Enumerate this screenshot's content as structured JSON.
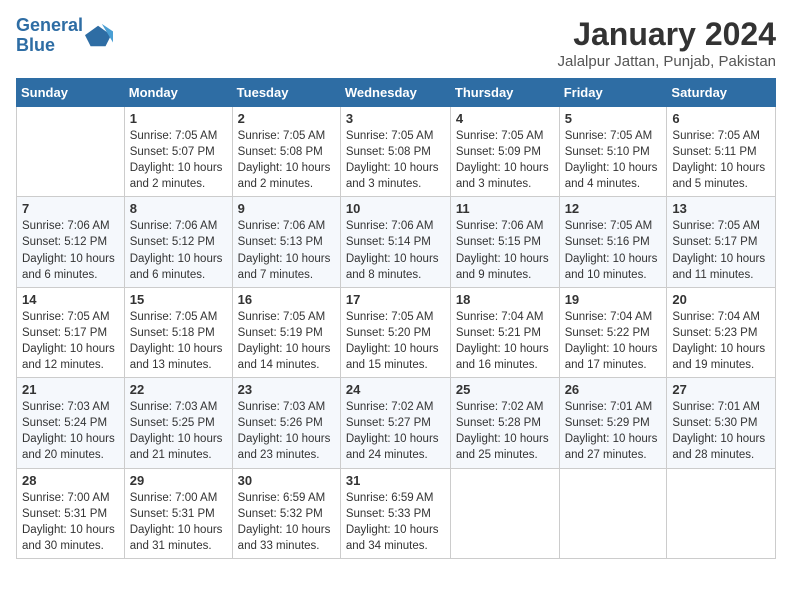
{
  "header": {
    "logo_line1": "General",
    "logo_line2": "Blue",
    "title": "January 2024",
    "subtitle": "Jalalpur Jattan, Punjab, Pakistan"
  },
  "weekdays": [
    "Sunday",
    "Monday",
    "Tuesday",
    "Wednesday",
    "Thursday",
    "Friday",
    "Saturday"
  ],
  "weeks": [
    [
      {
        "day": "",
        "info": ""
      },
      {
        "day": "1",
        "info": "Sunrise: 7:05 AM\nSunset: 5:07 PM\nDaylight: 10 hours\nand 2 minutes."
      },
      {
        "day": "2",
        "info": "Sunrise: 7:05 AM\nSunset: 5:08 PM\nDaylight: 10 hours\nand 2 minutes."
      },
      {
        "day": "3",
        "info": "Sunrise: 7:05 AM\nSunset: 5:08 PM\nDaylight: 10 hours\nand 3 minutes."
      },
      {
        "day": "4",
        "info": "Sunrise: 7:05 AM\nSunset: 5:09 PM\nDaylight: 10 hours\nand 3 minutes."
      },
      {
        "day": "5",
        "info": "Sunrise: 7:05 AM\nSunset: 5:10 PM\nDaylight: 10 hours\nand 4 minutes."
      },
      {
        "day": "6",
        "info": "Sunrise: 7:05 AM\nSunset: 5:11 PM\nDaylight: 10 hours\nand 5 minutes."
      }
    ],
    [
      {
        "day": "7",
        "info": "Sunrise: 7:06 AM\nSunset: 5:12 PM\nDaylight: 10 hours\nand 6 minutes."
      },
      {
        "day": "8",
        "info": "Sunrise: 7:06 AM\nSunset: 5:12 PM\nDaylight: 10 hours\nand 6 minutes."
      },
      {
        "day": "9",
        "info": "Sunrise: 7:06 AM\nSunset: 5:13 PM\nDaylight: 10 hours\nand 7 minutes."
      },
      {
        "day": "10",
        "info": "Sunrise: 7:06 AM\nSunset: 5:14 PM\nDaylight: 10 hours\nand 8 minutes."
      },
      {
        "day": "11",
        "info": "Sunrise: 7:06 AM\nSunset: 5:15 PM\nDaylight: 10 hours\nand 9 minutes."
      },
      {
        "day": "12",
        "info": "Sunrise: 7:05 AM\nSunset: 5:16 PM\nDaylight: 10 hours\nand 10 minutes."
      },
      {
        "day": "13",
        "info": "Sunrise: 7:05 AM\nSunset: 5:17 PM\nDaylight: 10 hours\nand 11 minutes."
      }
    ],
    [
      {
        "day": "14",
        "info": "Sunrise: 7:05 AM\nSunset: 5:17 PM\nDaylight: 10 hours\nand 12 minutes."
      },
      {
        "day": "15",
        "info": "Sunrise: 7:05 AM\nSunset: 5:18 PM\nDaylight: 10 hours\nand 13 minutes."
      },
      {
        "day": "16",
        "info": "Sunrise: 7:05 AM\nSunset: 5:19 PM\nDaylight: 10 hours\nand 14 minutes."
      },
      {
        "day": "17",
        "info": "Sunrise: 7:05 AM\nSunset: 5:20 PM\nDaylight: 10 hours\nand 15 minutes."
      },
      {
        "day": "18",
        "info": "Sunrise: 7:04 AM\nSunset: 5:21 PM\nDaylight: 10 hours\nand 16 minutes."
      },
      {
        "day": "19",
        "info": "Sunrise: 7:04 AM\nSunset: 5:22 PM\nDaylight: 10 hours\nand 17 minutes."
      },
      {
        "day": "20",
        "info": "Sunrise: 7:04 AM\nSunset: 5:23 PM\nDaylight: 10 hours\nand 19 minutes."
      }
    ],
    [
      {
        "day": "21",
        "info": "Sunrise: 7:03 AM\nSunset: 5:24 PM\nDaylight: 10 hours\nand 20 minutes."
      },
      {
        "day": "22",
        "info": "Sunrise: 7:03 AM\nSunset: 5:25 PM\nDaylight: 10 hours\nand 21 minutes."
      },
      {
        "day": "23",
        "info": "Sunrise: 7:03 AM\nSunset: 5:26 PM\nDaylight: 10 hours\nand 23 minutes."
      },
      {
        "day": "24",
        "info": "Sunrise: 7:02 AM\nSunset: 5:27 PM\nDaylight: 10 hours\nand 24 minutes."
      },
      {
        "day": "25",
        "info": "Sunrise: 7:02 AM\nSunset: 5:28 PM\nDaylight: 10 hours\nand 25 minutes."
      },
      {
        "day": "26",
        "info": "Sunrise: 7:01 AM\nSunset: 5:29 PM\nDaylight: 10 hours\nand 27 minutes."
      },
      {
        "day": "27",
        "info": "Sunrise: 7:01 AM\nSunset: 5:30 PM\nDaylight: 10 hours\nand 28 minutes."
      }
    ],
    [
      {
        "day": "28",
        "info": "Sunrise: 7:00 AM\nSunset: 5:31 PM\nDaylight: 10 hours\nand 30 minutes."
      },
      {
        "day": "29",
        "info": "Sunrise: 7:00 AM\nSunset: 5:31 PM\nDaylight: 10 hours\nand 31 minutes."
      },
      {
        "day": "30",
        "info": "Sunrise: 6:59 AM\nSunset: 5:32 PM\nDaylight: 10 hours\nand 33 minutes."
      },
      {
        "day": "31",
        "info": "Sunrise: 6:59 AM\nSunset: 5:33 PM\nDaylight: 10 hours\nand 34 minutes."
      },
      {
        "day": "",
        "info": ""
      },
      {
        "day": "",
        "info": ""
      },
      {
        "day": "",
        "info": ""
      }
    ]
  ]
}
